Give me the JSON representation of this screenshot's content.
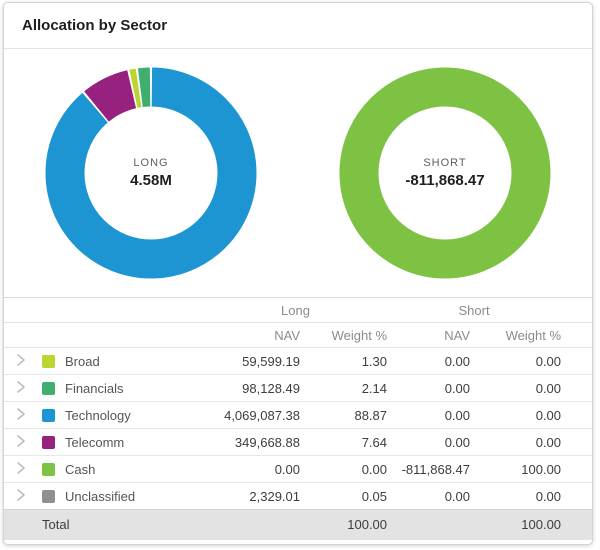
{
  "card": {
    "title": "Allocation by Sector"
  },
  "chart_data": [
    {
      "type": "pie",
      "variant": "donut",
      "center_label": "LONG",
      "center_value": "4.58M",
      "segments": [
        {
          "label": "Technology",
          "value_pct": 88.87,
          "color": "#1d95d3"
        },
        {
          "label": "Telecomm",
          "value_pct": 7.64,
          "color": "#97217e"
        },
        {
          "label": "Broad",
          "value_pct": 1.3,
          "color": "#bdd62f"
        },
        {
          "label": "Financials",
          "value_pct": 2.14,
          "color": "#3fae6e"
        },
        {
          "label": "Unclassified",
          "value_pct": 0.05,
          "color": "#8e9091"
        }
      ]
    },
    {
      "type": "pie",
      "variant": "donut",
      "center_label": "SHORT",
      "center_value": "-811,868.47",
      "segments": [
        {
          "label": "Cash",
          "value_pct": 100.0,
          "color": "#7dc242"
        }
      ]
    }
  ],
  "table": {
    "group_headers": {
      "long": "Long",
      "short": "Short"
    },
    "col_headers": {
      "nav_long": "NAV",
      "weight_long": "Weight %",
      "nav_short": "NAV",
      "weight_short": "Weight %"
    },
    "rows": [
      {
        "name": "Broad",
        "color": "#bdd62f",
        "long_nav": "59,599.19",
        "long_weight": "1.30",
        "short_nav": "0.00",
        "short_weight": "0.00"
      },
      {
        "name": "Financials",
        "color": "#3fae6e",
        "long_nav": "98,128.49",
        "long_weight": "2.14",
        "short_nav": "0.00",
        "short_weight": "0.00"
      },
      {
        "name": "Technology",
        "color": "#1d95d3",
        "long_nav": "4,069,087.38",
        "long_weight": "88.87",
        "short_nav": "0.00",
        "short_weight": "0.00"
      },
      {
        "name": "Telecomm",
        "color": "#97217e",
        "long_nav": "349,668.88",
        "long_weight": "7.64",
        "short_nav": "0.00",
        "short_weight": "0.00"
      },
      {
        "name": "Cash",
        "color": "#7dc242",
        "long_nav": "0.00",
        "long_weight": "0.00",
        "short_nav": "-811,868.47",
        "short_weight": "100.00"
      },
      {
        "name": "Unclassified",
        "color": "#8e9091",
        "long_nav": "2,329.01",
        "long_weight": "0.05",
        "short_nav": "0.00",
        "short_weight": "0.00"
      }
    ],
    "total": {
      "label": "Total",
      "long_weight": "100.00",
      "short_weight": "100.00"
    }
  }
}
